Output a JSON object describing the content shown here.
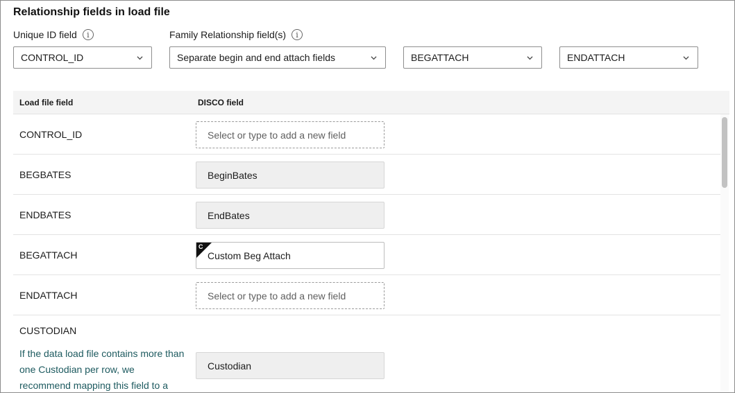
{
  "section": {
    "title": "Relationship fields in load file"
  },
  "unique_id": {
    "label": "Unique ID field",
    "info_icon": "info-icon",
    "value": "CONTROL_ID"
  },
  "family": {
    "label": "Family Relationship field(s)",
    "info_icon": "info-icon",
    "mode_value": "Separate begin and end attach fields",
    "begin_value": "BEGATTACH",
    "end_value": "ENDATTACH"
  },
  "table": {
    "headers": {
      "load_file": "Load file field",
      "disco": "DISCO field"
    },
    "rows": [
      {
        "load_field": "CONTROL_ID",
        "disco": "Select or type to add a new field",
        "state": "placeholder"
      },
      {
        "load_field": "BEGBATES",
        "disco": "BeginBates",
        "state": "mapped"
      },
      {
        "load_field": "ENDBATES",
        "disco": "EndBates",
        "state": "mapped"
      },
      {
        "load_field": "BEGATTACH",
        "disco": "Custom Beg Attach",
        "state": "custom",
        "badge": "C"
      },
      {
        "load_field": "ENDATTACH",
        "disco": "Select or type to add a new field",
        "state": "placeholder"
      },
      {
        "load_field": "CUSTODIAN",
        "disco": "Custodian",
        "state": "mapped",
        "note": "If the data load file contains more than one Custodian per row, we recommend mapping this field to a"
      }
    ]
  },
  "colors": {
    "note_text": "#1d5a5f",
    "badge": "#111111",
    "header_bg": "#f4f4f4"
  }
}
